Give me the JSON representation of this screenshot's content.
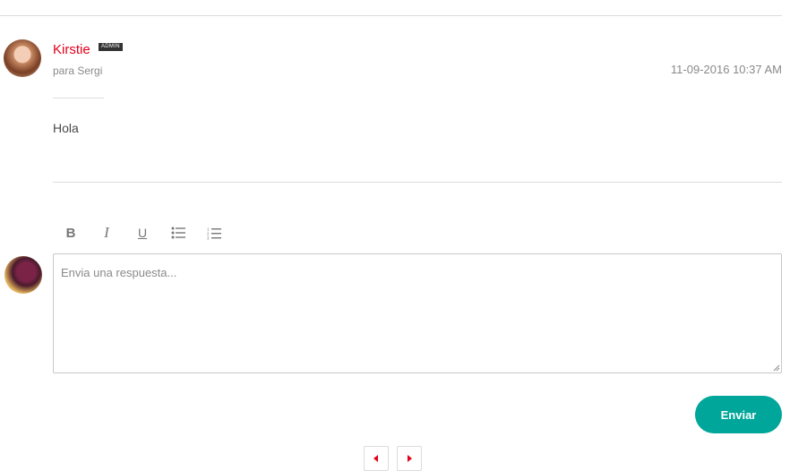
{
  "message": {
    "author": "Kirstie",
    "badge": "ADMIN",
    "recipient": "para Sergi",
    "timestamp": "11-09-2016 10:37 AM",
    "body": "Hola"
  },
  "editor": {
    "toolbar": {
      "bold": "B",
      "italic": "I",
      "underline": "U"
    },
    "placeholder": "Envia una respuesta...",
    "send_label": "Enviar"
  },
  "colors": {
    "author_name": "#e2001a",
    "send_button": "#00a699",
    "pagination_arrow": "#e2001a"
  },
  "icons": {
    "bullet_list": "bullet-list-icon",
    "numbered_list": "numbered-list-icon",
    "prev": "arrow-left-icon",
    "next": "arrow-right-icon"
  }
}
